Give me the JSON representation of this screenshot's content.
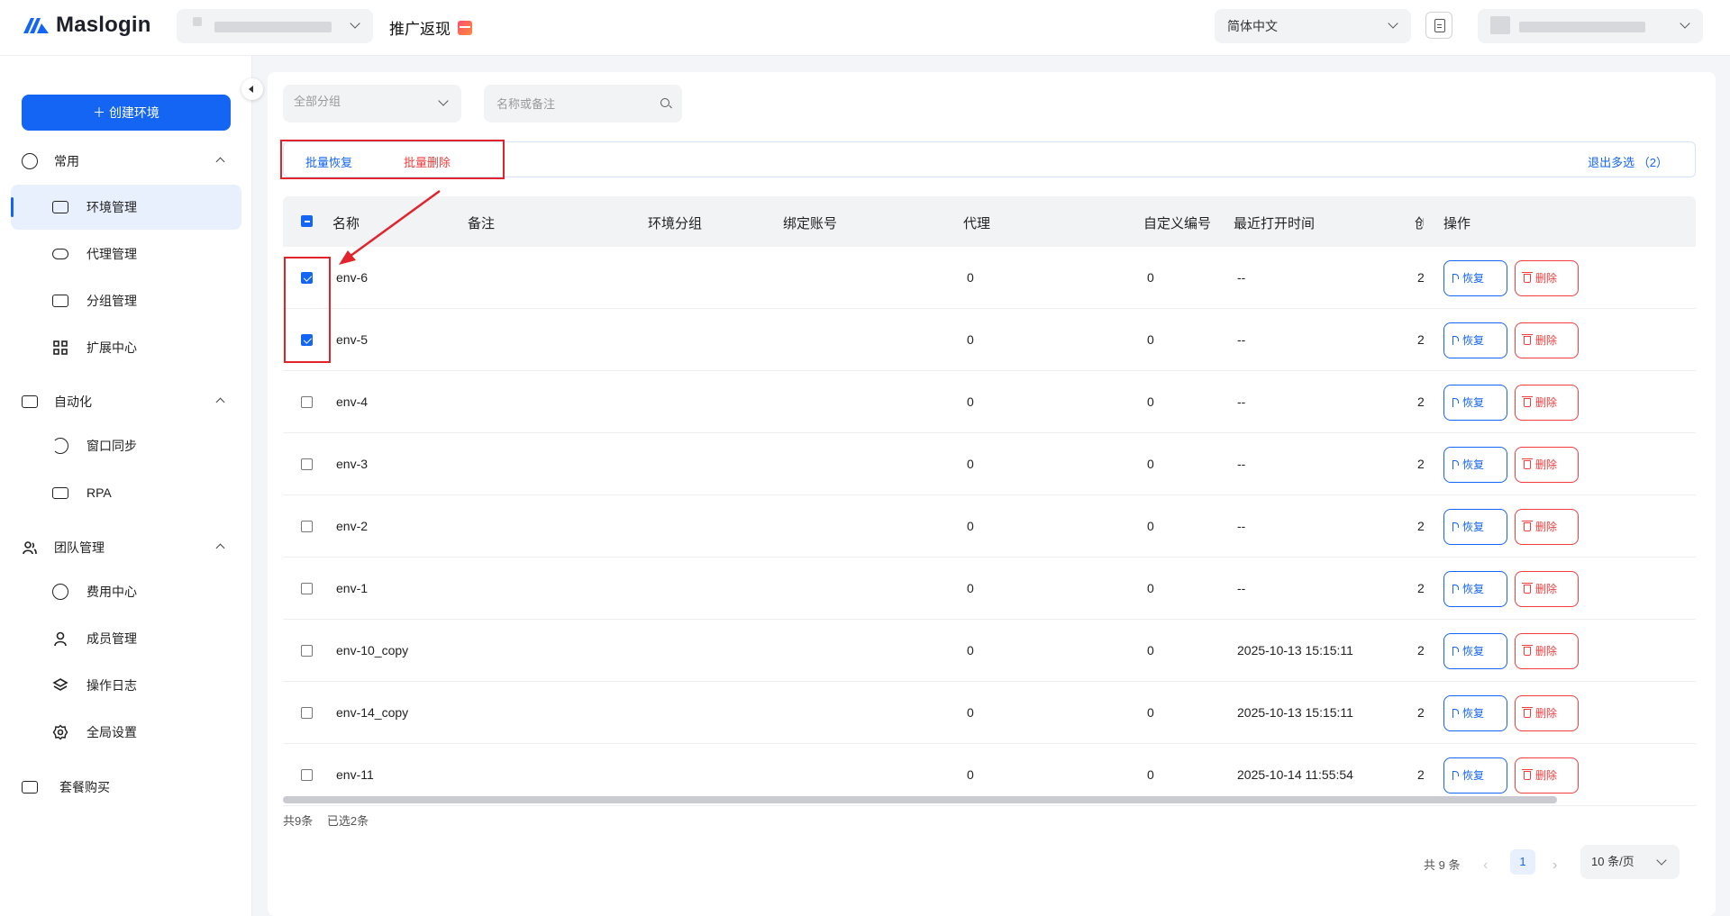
{
  "header": {
    "app_name": "Maslogin",
    "promo_label": "推广返现",
    "language": "简体中文"
  },
  "sidebar": {
    "create_button": "创建环境",
    "groups": [
      {
        "label": "常用",
        "items": [
          "环境管理",
          "代理管理",
          "分组管理",
          "扩展中心"
        ]
      },
      {
        "label": "自动化",
        "items": [
          "窗口同步",
          "RPA"
        ]
      },
      {
        "label": "团队管理",
        "items": [
          "费用中心",
          "成员管理",
          "操作日志",
          "全局设置"
        ]
      }
    ],
    "bottom_item": "套餐购买",
    "active_item": "环境管理"
  },
  "filters": {
    "group_select": "全部分组",
    "search_placeholder": "名称或备注"
  },
  "batch_bar": {
    "restore": "批量恢复",
    "delete": "批量删除",
    "exit_multi": "退出多选 （2）"
  },
  "table": {
    "columns": [
      "名称",
      "备注",
      "环境分组",
      "绑定账号",
      "代理",
      "自定义编号",
      "最近打开时间",
      "创",
      "操作"
    ],
    "rows": [
      {
        "name": "env-6",
        "proxy": "0",
        "custom_no": "0",
        "last_open": "--",
        "col8": "2",
        "checked": true
      },
      {
        "name": "env-5",
        "proxy": "0",
        "custom_no": "0",
        "last_open": "--",
        "col8": "2",
        "checked": true
      },
      {
        "name": "env-4",
        "proxy": "0",
        "custom_no": "0",
        "last_open": "--",
        "col8": "2",
        "checked": false
      },
      {
        "name": "env-3",
        "proxy": "0",
        "custom_no": "0",
        "last_open": "--",
        "col8": "2",
        "checked": false
      },
      {
        "name": "env-2",
        "proxy": "0",
        "custom_no": "0",
        "last_open": "--",
        "col8": "2",
        "checked": false
      },
      {
        "name": "env-1",
        "proxy": "0",
        "custom_no": "0",
        "last_open": "--",
        "col8": "2",
        "checked": false
      },
      {
        "name": "env-10_copy",
        "proxy": "0",
        "custom_no": "0",
        "last_open": "2025-10-13 15:15:11",
        "col8": "2",
        "checked": false
      },
      {
        "name": "env-14_copy",
        "proxy": "0",
        "custom_no": "0",
        "last_open": "2025-10-13 15:15:11",
        "col8": "2",
        "checked": false
      },
      {
        "name": "env-11",
        "proxy": "0",
        "custom_no": "0",
        "last_open": "2025-10-14 11:55:54",
        "col8": "2",
        "checked": false
      }
    ],
    "restore_label": "恢复",
    "delete_label": "删除"
  },
  "footer": {
    "total": "共9条",
    "selected": "已选2条"
  },
  "pagination": {
    "total": "共 9 条",
    "current_page": "1",
    "page_size": "10 条/页"
  },
  "colors": {
    "primary": "#1565f5",
    "danger": "#f23d3d",
    "annotation": "#e3232c"
  }
}
